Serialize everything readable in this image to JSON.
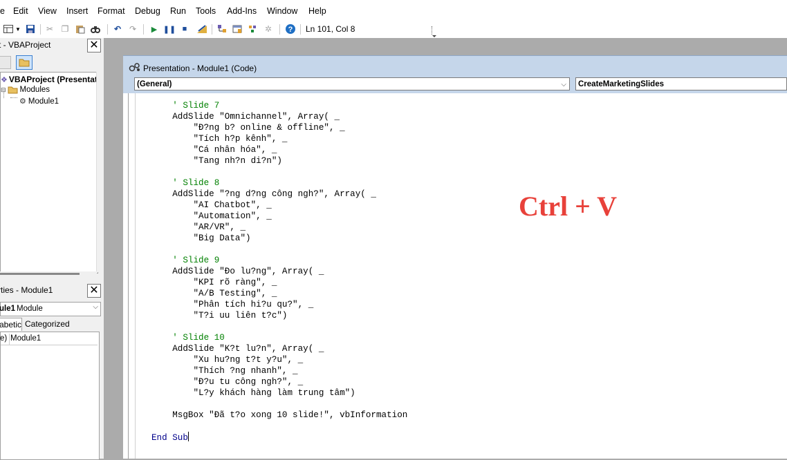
{
  "menu": [
    "e",
    "Edit",
    "View",
    "Insert",
    "Format",
    "Debug",
    "Run",
    "Tools",
    "Add-Ins",
    "Window",
    "Help"
  ],
  "toolbar": {
    "status": "Ln 101, Col 8"
  },
  "project_pane": {
    "title": "t - VBAProject",
    "close": "✕",
    "root": "VBAProject (Presentati",
    "folder": "Modules",
    "module": "Module1"
  },
  "properties_pane": {
    "title": "rties - Module1",
    "close": "✕",
    "object_bold": "ule1",
    "object_type": "Module",
    "tab_alpha": "abetic",
    "tab_cat": "Categorized",
    "row_key": "e)",
    "row_value": "Module1"
  },
  "code_window": {
    "title": "Presentation - Module1 (Code)",
    "object_combo": "(General)",
    "proc_combo": "CreateMarketingSlides"
  },
  "code_lines": [
    {
      "t": "    ' Slide 7",
      "c": "cmt"
    },
    {
      "t": "    AddSlide \"Omnichannel\", Array( _",
      "c": ""
    },
    {
      "t": "        \"Đ?ng b? online & offline\", _",
      "c": ""
    },
    {
      "t": "        \"Tích h?p kênh\", _",
      "c": ""
    },
    {
      "t": "        \"Cá nhân hóa\", _",
      "c": ""
    },
    {
      "t": "        \"Tang nh?n di?n\")",
      "c": ""
    },
    {
      "t": "",
      "c": ""
    },
    {
      "t": "    ' Slide 8",
      "c": "cmt"
    },
    {
      "t": "    AddSlide \"?ng d?ng công ngh?\", Array( _",
      "c": ""
    },
    {
      "t": "        \"AI Chatbot\", _",
      "c": ""
    },
    {
      "t": "        \"Automation\", _",
      "c": ""
    },
    {
      "t": "        \"AR/VR\", _",
      "c": ""
    },
    {
      "t": "        \"Big Data\")",
      "c": ""
    },
    {
      "t": "",
      "c": ""
    },
    {
      "t": "    ' Slide 9",
      "c": "cmt"
    },
    {
      "t": "    AddSlide \"Đo lu?ng\", Array( _",
      "c": ""
    },
    {
      "t": "        \"KPI rõ ràng\", _",
      "c": ""
    },
    {
      "t": "        \"A/B Testing\", _",
      "c": ""
    },
    {
      "t": "        \"Phân tích hi?u qu?\", _",
      "c": ""
    },
    {
      "t": "        \"T?i uu liên t?c\")",
      "c": ""
    },
    {
      "t": "",
      "c": ""
    },
    {
      "t": "    ' Slide 10",
      "c": "cmt"
    },
    {
      "t": "    AddSlide \"K?t lu?n\", Array( _",
      "c": ""
    },
    {
      "t": "        \"Xu hu?ng t?t y?u\", _",
      "c": ""
    },
    {
      "t": "        \"Thích ?ng nhanh\", _",
      "c": ""
    },
    {
      "t": "        \"Đ?u tu công ngh?\", _",
      "c": ""
    },
    {
      "t": "        \"L?y khách hàng làm trung tâm\")",
      "c": ""
    },
    {
      "t": "",
      "c": ""
    },
    {
      "t": "    MsgBox \"Đã t?o xong 10 slide!\", vbInformation",
      "c": ""
    },
    {
      "t": "",
      "c": ""
    },
    {
      "t": "End Sub",
      "c": "kw"
    }
  ],
  "overlay_text": "Ctrl + V"
}
